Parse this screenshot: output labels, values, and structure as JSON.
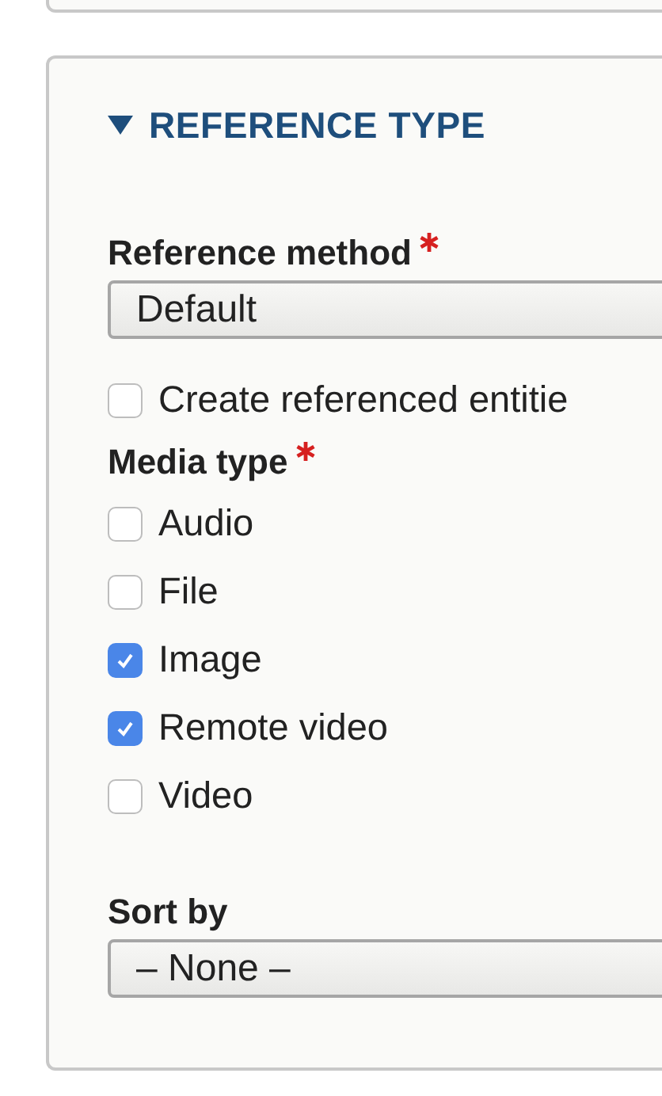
{
  "section": {
    "title": "REFERENCE TYPE",
    "expanded": true
  },
  "reference_method": {
    "label": "Reference method",
    "required": true,
    "value": "Default"
  },
  "create_entities": {
    "label": "Create referenced entitie",
    "checked": false
  },
  "media_type": {
    "label": "Media type",
    "required": true,
    "options": [
      {
        "label": "Audio",
        "checked": false
      },
      {
        "label": "File",
        "checked": false
      },
      {
        "label": "Image",
        "checked": true
      },
      {
        "label": "Remote video",
        "checked": true
      },
      {
        "label": "Video",
        "checked": false
      }
    ]
  },
  "sort_by": {
    "label": "Sort by",
    "value": "– None –"
  }
}
